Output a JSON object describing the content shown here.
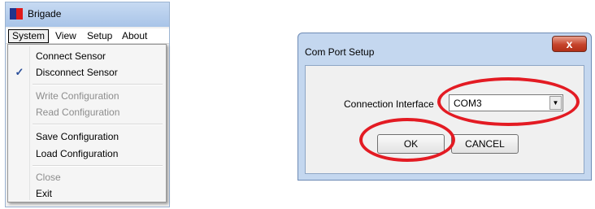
{
  "app_window": {
    "title": "Brigade",
    "menubar": [
      "System",
      "View",
      "Setup",
      "About"
    ],
    "system_menu": {
      "items": [
        {
          "label": "Connect Sensor",
          "enabled": true,
          "checked": false
        },
        {
          "label": "Disconnect Sensor",
          "enabled": true,
          "checked": true
        },
        {
          "label": "Write Configuration",
          "enabled": false,
          "checked": false
        },
        {
          "label": "Read Configuration",
          "enabled": false,
          "checked": false
        },
        {
          "label": "Save Configuration",
          "enabled": true,
          "checked": false
        },
        {
          "label": "Load Configuration",
          "enabled": true,
          "checked": false
        },
        {
          "label": "Close",
          "enabled": false,
          "checked": false
        },
        {
          "label": "Exit",
          "enabled": true,
          "checked": false
        }
      ],
      "check_glyph": "✓"
    }
  },
  "dialog": {
    "title": "Com Port Setup",
    "close_glyph": "x",
    "connection_label": "Connection Interface",
    "combo_value": "COM3",
    "combo_arrow_glyph": "▼",
    "ok_label": "OK",
    "cancel_label": "CANCEL"
  },
  "colors": {
    "annotation_red": "#e31b23",
    "checkmark_blue": "#2a4f9a",
    "disabled_text": "#8d8d8d"
  }
}
